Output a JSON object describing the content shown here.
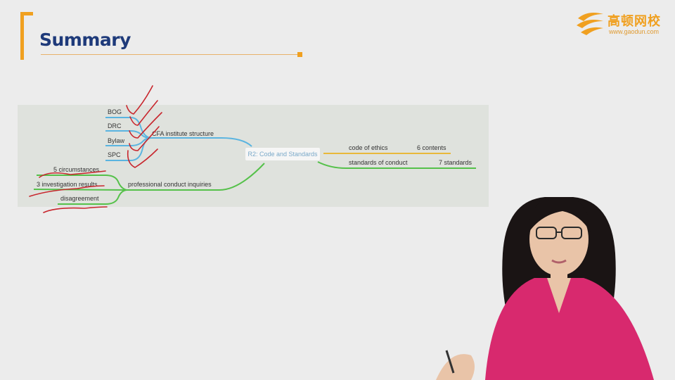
{
  "header": {
    "title": "Summary",
    "logo_text": "高顿网校",
    "logo_url": "www.gaodun.com"
  },
  "mindmap": {
    "center": "R2: Code and Standards",
    "branches": {
      "structure": {
        "label": "CFA institute structure",
        "items": [
          "BOG",
          "DRC",
          "Bylaw",
          "SPC"
        ]
      },
      "inquiries": {
        "label": "professional conduct inquiries",
        "items": [
          "5 circumstances",
          "3 investigation results",
          "disagreement"
        ]
      },
      "code": {
        "label": "code of ethics",
        "note": "6 contents"
      },
      "standards": {
        "label": "standards of conduct",
        "note": "7 standards"
      }
    }
  },
  "colors": {
    "structure": "#5ab4e0",
    "inquiries": "#55c14a",
    "code": "#e8b83a",
    "standards": "#55c14a",
    "annotation": "#c8262d",
    "accent": "#f0a020",
    "title": "#1e3a7a"
  }
}
